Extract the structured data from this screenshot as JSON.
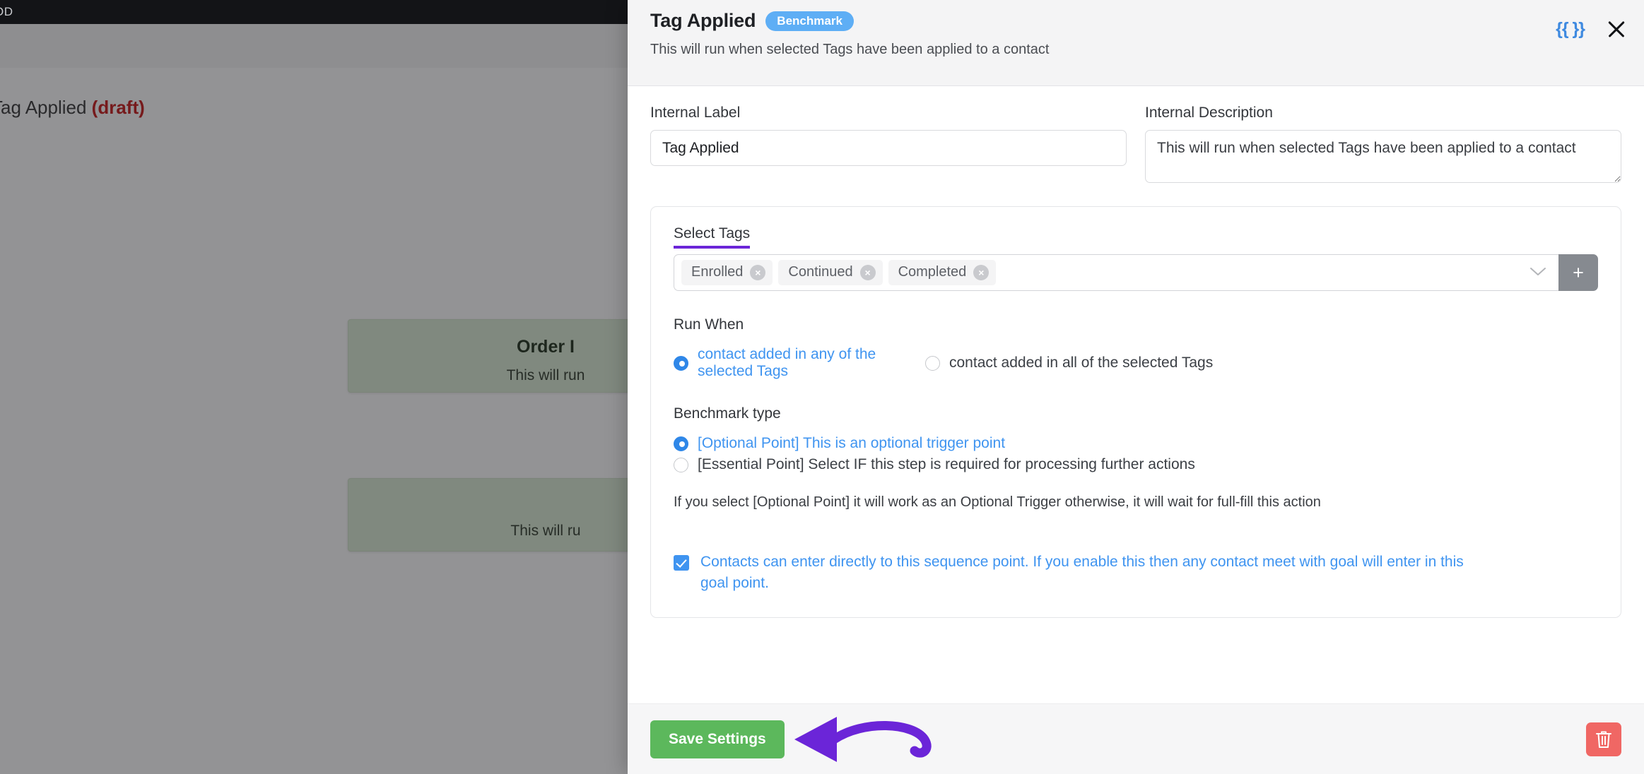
{
  "background": {
    "topbar_text": "OD",
    "page_title": "Tag Applied ",
    "page_title_status": "(draft)",
    "nodes": [
      {
        "title": "Order I",
        "subtitle": "This will run"
      },
      {
        "title": "",
        "subtitle": "This will ru"
      }
    ]
  },
  "header": {
    "title": "Tag Applied",
    "badge": "Benchmark",
    "subtitle": "This will run when selected Tags have been applied to a contact",
    "merge_field_icon": "{{ }}",
    "close_icon": "close-icon"
  },
  "form": {
    "internal_label": {
      "label": "Internal Label",
      "value": "Tag Applied",
      "placeholder": "Internal Label"
    },
    "internal_description": {
      "label": "Internal Description",
      "value": "This will run when selected Tags have been applied to a contact",
      "placeholder": "Internal Description"
    }
  },
  "select_tags": {
    "label": "Select Tags",
    "chips": [
      {
        "label": "Enrolled",
        "remove": "×"
      },
      {
        "label": "Continued",
        "remove": "×"
      },
      {
        "label": "Completed",
        "remove": "×"
      }
    ],
    "caret_icon": "⌄",
    "add_button_label": "+"
  },
  "run_when": {
    "title": "Run When",
    "options": [
      {
        "label": "contact added in any of the selected Tags",
        "selected": true
      },
      {
        "label": "contact added in all of the selected Tags",
        "selected": false
      }
    ]
  },
  "benchmark_type": {
    "title": "Benchmark type",
    "options": [
      {
        "label": "[Optional Point] This is an optional trigger point",
        "selected": true
      },
      {
        "label": "[Essential Point] Select IF this step is required for processing further actions",
        "selected": false
      }
    ],
    "hint": "If you select [Optional Point] it will work as an Optional Trigger otherwise, it will wait for full-fill this action"
  },
  "direct_entry": {
    "checked": true,
    "label": "Contacts can enter directly to this sequence point. If you enable this then any contact meet with goal will enter in this goal point."
  },
  "footer": {
    "save_label": "Save Settings",
    "delete_icon": "trash-icon"
  },
  "colors": {
    "accent_purple": "#6b25d8",
    "link_blue": "#3f94f0",
    "badge_blue": "#5eaef5",
    "save_green": "#5cb85c",
    "delete_red": "#f06764",
    "draft_red": "#c40d0d",
    "node_green": "#d9ead3"
  }
}
